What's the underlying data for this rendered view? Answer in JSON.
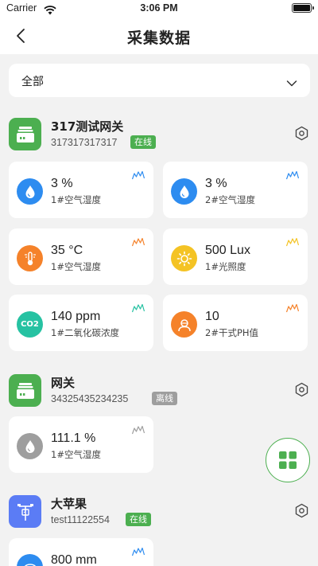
{
  "status_bar": {
    "carrier": "Carrier",
    "time": "3:06 PM",
    "battery_level": 1.0
  },
  "nav": {
    "title": "采集数据",
    "back_icon": "chevron-left-icon"
  },
  "filter": {
    "selected": "全部",
    "icon": "chevron-down-icon"
  },
  "gateways": [
    {
      "name": "317测试网关",
      "id": "317317317317",
      "status": "在线",
      "status_color": "#4caf50",
      "icon_color": "#4caf50",
      "icon": "gateway-icon",
      "sensors": [
        {
          "value": "3 %",
          "label": "1#空气湿度",
          "icon": "humidity-icon",
          "color": "#2d8cf0",
          "trend_color": "#2d8cf0"
        },
        {
          "value": "3 %",
          "label": "2#空气湿度",
          "icon": "humidity-icon",
          "color": "#2d8cf0",
          "trend_color": "#2d8cf0"
        },
        {
          "value": "35 °C",
          "label": "1#空气湿度",
          "icon": "thermometer-icon",
          "color": "#f5822a",
          "trend_color": "#f5822a"
        },
        {
          "value": "500 Lux",
          "label": "1#光照度",
          "icon": "sun-icon",
          "color": "#f4c324",
          "trend_color": "#f4c324"
        },
        {
          "value": "140 ppm",
          "label": "1#二氧化碳浓度",
          "icon": "co2-icon",
          "icon_text": "CO2",
          "color": "#26c2a2",
          "trend_color": "#26c2a2"
        },
        {
          "value": "10",
          "label": "2#干式PH值",
          "icon": "ph-sensor-icon",
          "color": "#f5822a",
          "trend_color": "#f5822a"
        }
      ]
    },
    {
      "name": "网关",
      "id": "34325435234235",
      "status": "离线",
      "status_color": "#9e9e9e",
      "icon_color": "#4caf50",
      "icon": "gateway-icon",
      "sensors": [
        {
          "value": "111.1 %",
          "label": "1#空气湿度",
          "icon": "humidity-icon",
          "color": "#9e9e9e",
          "trend_color": "#9e9e9e"
        }
      ]
    },
    {
      "name": "大苹果",
      "id": "test11122554",
      "status": "在线",
      "status_color": "#4caf50",
      "icon_color": "#5b7cf5",
      "icon": "weather-station-icon",
      "sensors": [
        {
          "value": "800 mm",
          "label": "",
          "icon": "rain-icon",
          "color": "#2d8cf0",
          "trend_color": "#2d8cf0"
        }
      ]
    }
  ],
  "fab": {
    "icon": "grid-icon",
    "color": "#4caf50"
  }
}
